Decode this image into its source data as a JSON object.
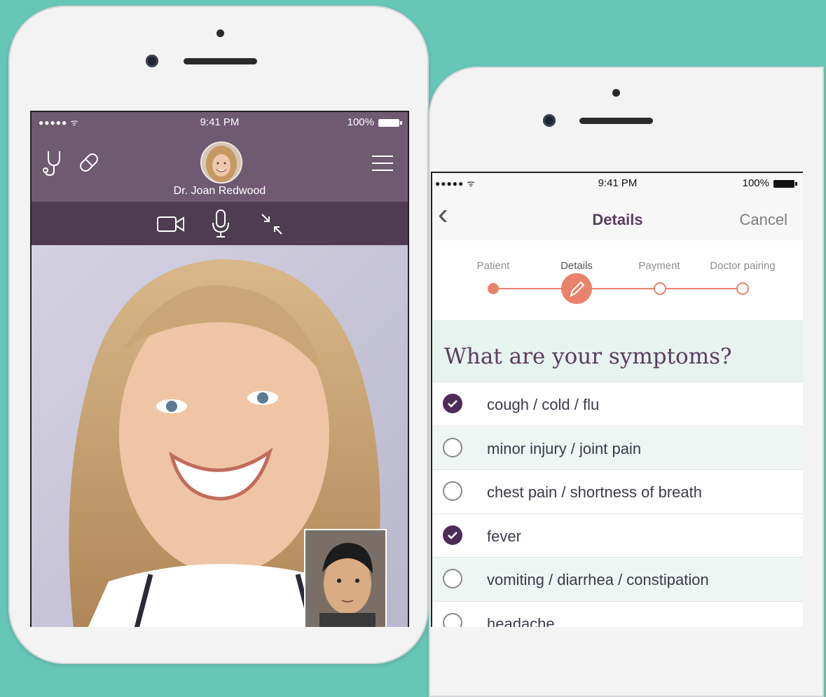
{
  "left_phone": {
    "status": {
      "signal": "●●●●● ᯤ",
      "time": "9:41 PM",
      "battery": "100%"
    },
    "doctor_name": "Dr. Joan Redwood",
    "icons": [
      "stethoscope-icon",
      "pill-icon",
      "menu-icon",
      "video-camera-icon",
      "microphone-icon",
      "minimize-icon"
    ]
  },
  "right_phone": {
    "status": {
      "signal": "●●●●● ᯤ",
      "time": "9:41 PM",
      "battery": "100%"
    },
    "nav": {
      "back": "‹",
      "title": "Details",
      "cancel": "Cancel"
    },
    "steps": [
      "Patient",
      "Details",
      "Payment",
      "Doctor pairing"
    ],
    "question": "What are your symptoms?",
    "symptoms": [
      {
        "label": "cough / cold / flu",
        "checked": true
      },
      {
        "label": "minor injury / joint pain",
        "checked": false
      },
      {
        "label": "chest pain / shortness of breath",
        "checked": false
      },
      {
        "label": "fever",
        "checked": true
      },
      {
        "label": "vomiting / diarrhea / constipation",
        "checked": false
      },
      {
        "label": "headache",
        "checked": false
      }
    ]
  },
  "colors": {
    "background": "#67c7b6",
    "header": "#6f5a72",
    "toolbar": "#4f3c52",
    "accent": "#e8826b",
    "checked": "#4e2c58",
    "title": "#5a3d5f"
  }
}
